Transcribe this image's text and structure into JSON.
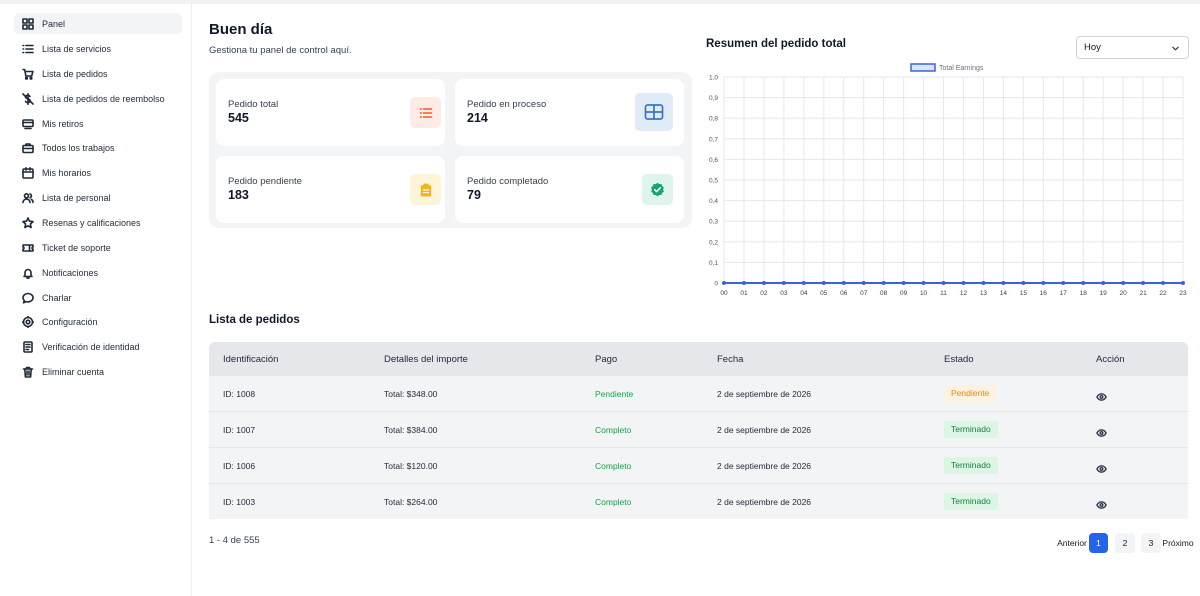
{
  "sidebar": {
    "items": [
      {
        "label": "Panel",
        "icon": "grid-icon",
        "active": true
      },
      {
        "label": "Lista de servicios",
        "icon": "list-icon"
      },
      {
        "label": "Lista de pedidos",
        "icon": "cart-icon"
      },
      {
        "label": "Lista de pedidos de reembolso",
        "icon": "refund-icon"
      },
      {
        "label": "Mis retiros",
        "icon": "withdraw-icon"
      },
      {
        "label": "Todos los trabajos",
        "icon": "briefcase-icon"
      },
      {
        "label": "Mis horarios",
        "icon": "calendar-icon"
      },
      {
        "label": "Lista de personal",
        "icon": "users-icon"
      },
      {
        "label": "Resenas y calificaciones",
        "icon": "star-icon"
      },
      {
        "label": "Ticket de soporte",
        "icon": "ticket-icon"
      },
      {
        "label": "Notificaciones",
        "icon": "bell-icon"
      },
      {
        "label": "Charlar",
        "icon": "chat-icon"
      },
      {
        "label": "Configuración",
        "icon": "gear-icon"
      },
      {
        "label": "Verificación de identidad",
        "icon": "id-icon"
      },
      {
        "label": "Eliminar cuenta",
        "icon": "trash-icon"
      }
    ]
  },
  "header": {
    "title": "Buen día",
    "subtitle": "Gestiona tu panel de control aquí."
  },
  "stats": [
    {
      "title": "Pedido total",
      "value": "545",
      "icon": "list-icon",
      "icon_bg": "#fdece6",
      "icon_color": "#f05a28"
    },
    {
      "title": "Pedido en proceso",
      "value": "214",
      "icon": "table-icon",
      "icon_bg": "#e0ebf8",
      "icon_color": "#3b78c4"
    },
    {
      "title": "Pedido pendiente",
      "value": "183",
      "icon": "clipboard-icon",
      "icon_bg": "#fdf4d9",
      "icon_color": "#f5b416"
    },
    {
      "title": "Pedido completado",
      "value": "79",
      "icon": "badge-check-icon",
      "icon_bg": "#dff4ec",
      "icon_color": "#15a473"
    }
  ],
  "chart_section": {
    "title": "Resumen del pedido total",
    "select_value": "Hoy"
  },
  "chart_data": {
    "type": "line",
    "categories": [
      "00",
      "01",
      "02",
      "03",
      "04",
      "05",
      "06",
      "07",
      "08",
      "09",
      "10",
      "11",
      "12",
      "13",
      "14",
      "15",
      "16",
      "17",
      "18",
      "19",
      "20",
      "21",
      "22",
      "23"
    ],
    "series": [
      {
        "name": "Total Earnings",
        "values": [
          0,
          0,
          0,
          0,
          0,
          0,
          0,
          0,
          0,
          0,
          0,
          0,
          0,
          0,
          0,
          0,
          0,
          0,
          0,
          0,
          0,
          0,
          0,
          0
        ],
        "color": "#3b63d8"
      }
    ],
    "y_ticks": [
      "0",
      "0,1",
      "0,2",
      "0,3",
      "0,4",
      "0,5",
      "0,6",
      "0,7",
      "0,8",
      "0,9",
      "1,0"
    ],
    "ylim": [
      0,
      1
    ],
    "grid": true,
    "legend": "top-center"
  },
  "orders": {
    "title": "Lista de pedidos",
    "columns": [
      "Identificación",
      "Detalles del importe",
      "Pago",
      "Fecha",
      "Estado",
      "Acción"
    ],
    "rows": [
      {
        "id": "ID: 1008",
        "amount": "Total: $348.00",
        "payment": "Pendiente",
        "date": "2 de septiembre de 2026",
        "status": "Pendiente",
        "status_kind": "pending"
      },
      {
        "id": "ID: 1007",
        "amount": "Total: $384.00",
        "payment": "Completo",
        "date": "2 de septiembre de 2026",
        "status": "Terminado",
        "status_kind": "done"
      },
      {
        "id": "ID: 1006",
        "amount": "Total: $120.00",
        "payment": "Completo",
        "date": "2 de septiembre de 2026",
        "status": "Terminado",
        "status_kind": "done"
      },
      {
        "id": "ID: 1003",
        "amount": "Total: $264.00",
        "payment": "Completo",
        "date": "2 de septiembre de 2026",
        "status": "Terminado",
        "status_kind": "done"
      }
    ],
    "range": "1 - 4 de 555",
    "pagination": {
      "prev": "Anterior",
      "pages": [
        "1",
        "2",
        "3"
      ],
      "current": "1",
      "next": "Próximo"
    }
  }
}
